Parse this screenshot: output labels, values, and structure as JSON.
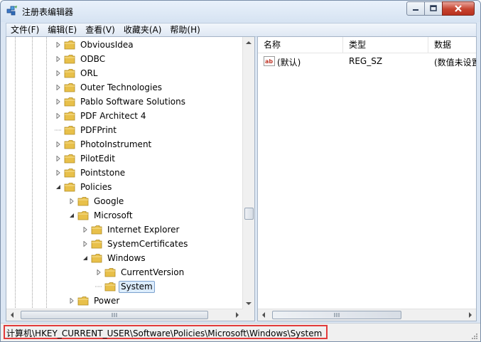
{
  "window": {
    "title": "注册表编辑器"
  },
  "menu": [
    "文件(F)",
    "编辑(E)",
    "查看(V)",
    "收藏夹(A)",
    "帮助(H)"
  ],
  "tree": {
    "items": [
      {
        "label": "ObviousIdea",
        "expander": "collapsed"
      },
      {
        "label": "ODBC",
        "expander": "collapsed"
      },
      {
        "label": "ORL",
        "expander": "collapsed"
      },
      {
        "label": "Outer Technologies",
        "expander": "collapsed"
      },
      {
        "label": "Pablo Software Solutions",
        "expander": "collapsed"
      },
      {
        "label": "PDF Architect 4",
        "expander": "collapsed"
      },
      {
        "label": "PDFPrint",
        "expander": "none"
      },
      {
        "label": "PhotoInstrument",
        "expander": "collapsed"
      },
      {
        "label": "PilotEdit",
        "expander": "collapsed"
      },
      {
        "label": "Pointstone",
        "expander": "collapsed"
      },
      {
        "label": "Policies",
        "expander": "expanded"
      },
      {
        "label": "Google",
        "expander": "collapsed"
      },
      {
        "label": "Microsoft",
        "expander": "expanded"
      },
      {
        "label": "Internet Explorer",
        "expander": "collapsed"
      },
      {
        "label": "SystemCertificates",
        "expander": "collapsed"
      },
      {
        "label": "Windows",
        "expander": "expanded"
      },
      {
        "label": "CurrentVersion",
        "expander": "collapsed"
      },
      {
        "label": "System",
        "expander": "none",
        "selected": true
      },
      {
        "label": "Power",
        "expander": "collapsed"
      }
    ]
  },
  "values": {
    "columns": [
      "名称",
      "类型",
      "数据"
    ],
    "rows": [
      {
        "name": "(默认)",
        "type": "REG_SZ",
        "data": "(数值未设置)",
        "icon": "string-value-icon"
      }
    ]
  },
  "statusbar": {
    "path": "计算机\\HKEY_CURRENT_USER\\Software\\Policies\\Microsoft\\Windows\\System"
  },
  "colors": {
    "highlight": "#e23b3b",
    "selection": "#dcecfc",
    "folder": "#e8c04a"
  }
}
